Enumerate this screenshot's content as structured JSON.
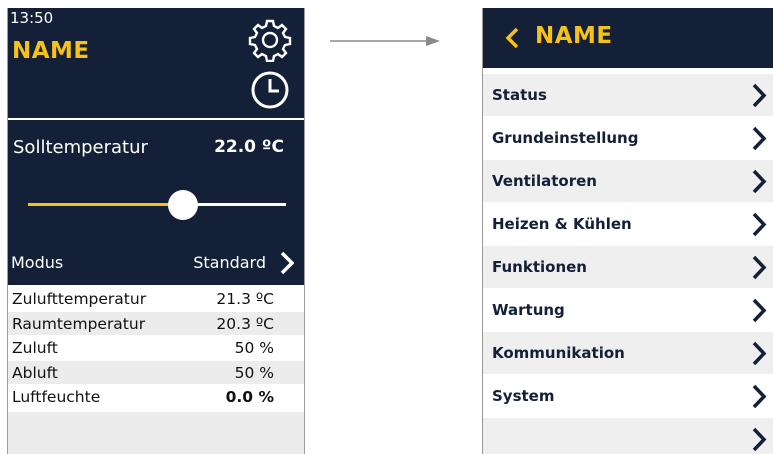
{
  "left": {
    "time": "13:50",
    "name": "NAME",
    "setpoint_label": "Solltemperatur",
    "setpoint_value": "22.0 ºC",
    "setpoint_slider_fraction": 0.6,
    "mode_label": "Modus",
    "mode_value": "Standard",
    "readings": [
      {
        "label": "Zulufttemperatur",
        "value": "21.3 ºC"
      },
      {
        "label": "Raumtemperatur",
        "value": "20.3 ºC"
      },
      {
        "label": "Zuluft",
        "value": "50 %"
      },
      {
        "label": "Abluft",
        "value": "50 %"
      },
      {
        "label": "Luftfeuchte",
        "value": "0.0 %"
      }
    ]
  },
  "right": {
    "name": "NAME",
    "menu": [
      {
        "label": "Status"
      },
      {
        "label": "Grundeinstellung"
      },
      {
        "label": "Ventilatoren"
      },
      {
        "label": "Heizen & Kühlen"
      },
      {
        "label": "Funktionen"
      },
      {
        "label": "Wartung"
      },
      {
        "label": "Kommunikation"
      },
      {
        "label": "System"
      },
      {
        "label": ""
      }
    ]
  },
  "colors": {
    "header_bg": "#142037",
    "accent": "#f6c21a",
    "text_dark": "#142037"
  },
  "icons": [
    "gear-icon",
    "clock-icon",
    "chevron-right-icon",
    "chevron-left-icon",
    "arrow-right-icon"
  ]
}
